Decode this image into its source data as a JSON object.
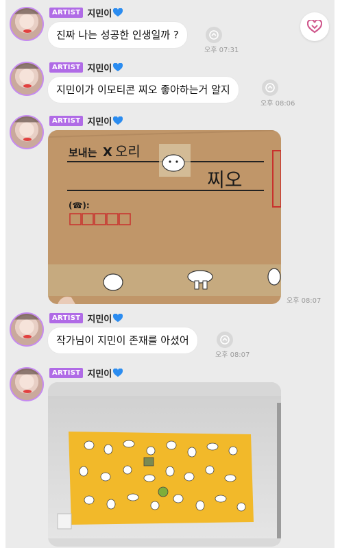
{
  "header": {
    "favorite_icon": "heart-outline-icon",
    "accent": "#d05a8e"
  },
  "artist_badge": "ARTIST",
  "sender_name": "지민이",
  "badge_color": "#b06be6",
  "messages": [
    {
      "text": "진짜 나는 성공한 인생일까 ?",
      "time": "오후 07:31"
    },
    {
      "text": "지민이가 이모티콘 찌오 좋아하는거 알지",
      "time": "오후 08:06"
    },
    {
      "image": "cardboard-box-photo",
      "time": "오후 08:07",
      "box_text": {
        "line1": "보내는",
        "crossed": "X",
        "line1b": "오리",
        "line2": "찌오",
        "phone_label": "(☎):"
      }
    },
    {
      "text": "작가님이 지민이 존재를 아셨어",
      "time": "오후 08:07"
    },
    {
      "image": "yellow-tapestry-photo"
    }
  ]
}
